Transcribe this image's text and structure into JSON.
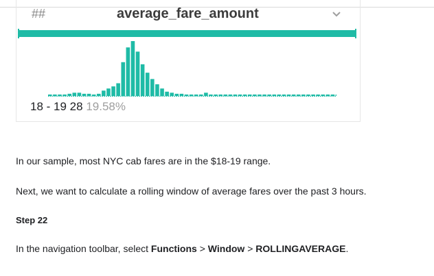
{
  "column_header": {
    "type_icon_text": "##",
    "name": "average_fare_amount",
    "dropdown_icon": "chevron-down-icon"
  },
  "colors": {
    "accent": "#1fbba6",
    "hover_pct": "#9e9e9e"
  },
  "chart_data": {
    "type": "bar",
    "values": [
      1,
      1,
      1,
      1,
      2,
      3,
      3,
      2,
      2,
      1,
      2,
      5,
      7,
      9,
      12,
      32,
      46,
      52,
      42,
      30,
      22,
      16,
      11,
      7,
      4,
      3,
      2,
      2,
      1,
      1,
      1,
      1,
      3,
      1,
      1,
      1,
      1,
      1,
      1,
      1,
      1,
      1,
      1,
      1,
      1,
      1,
      1,
      1,
      1,
      1,
      1,
      1,
      1,
      1,
      1,
      1,
      1,
      1,
      1,
      1,
      1,
      2
    ],
    "hover": {
      "range": "18 - 19",
      "count": "28",
      "percent": "19.58%"
    }
  },
  "content": {
    "p1": "In our sample, most NYC cab fares are in the $18-19 range.",
    "p2": "Next, we want to calculate a rolling window of average fares over the past 3 hours.",
    "step": "Step 22",
    "p3_prefix": "In the navigation toolbar, select ",
    "p3_functions": "Functions",
    "p3_sep1": " > ",
    "p3_window": "Window",
    "p3_sep2": " > ",
    "p3_rolling": "ROLLINGAVERAGE",
    "p3_suffix": "."
  }
}
